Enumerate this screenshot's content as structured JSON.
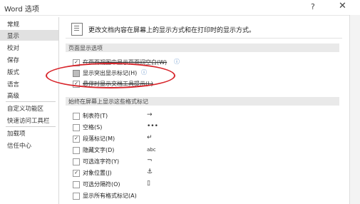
{
  "window": {
    "title": "Word 选项",
    "help": "?",
    "close": "✕"
  },
  "nav": {
    "items": [
      {
        "label": "常规"
      },
      {
        "label": "显示",
        "active": true
      },
      {
        "label": "校对"
      },
      {
        "label": "保存"
      },
      {
        "label": "版式"
      },
      {
        "label": "语言"
      },
      {
        "label": "高级"
      },
      {
        "label": "自定义功能区"
      },
      {
        "label": "快速访问工具栏"
      },
      {
        "label": "加载项"
      },
      {
        "label": "信任中心"
      }
    ]
  },
  "main": {
    "header": "更改文档内容在屏幕上的显示方式和在打印时的显示方式。",
    "page_display": {
      "title": "页面显示选项",
      "options": [
        {
          "label": "在页面视图中显示页面间空白(W)",
          "checked": true,
          "info": "ⓘ"
        },
        {
          "label": "显示突出显示标记(H)",
          "checked": false,
          "info": "ⓘ"
        },
        {
          "label": "悬停时显示文档工具提示(L)",
          "checked": true,
          "info": ""
        }
      ]
    },
    "format_marks": {
      "title": "始终在屏幕上显示这些格式标记",
      "options": [
        {
          "label": "制表符(T)",
          "checked": false,
          "symbol": "→"
        },
        {
          "label": "空格(S)",
          "checked": false,
          "symbol": "•••"
        },
        {
          "label": "段落标记(M)",
          "checked": true,
          "symbol": "↵"
        },
        {
          "label": "隐藏文字(D)",
          "checked": false,
          "symbol": "abc"
        },
        {
          "label": "可选连字符(Y)",
          "checked": false,
          "symbol": "¬"
        },
        {
          "label": "对象位置(J)",
          "checked": true,
          "symbol": "⚓"
        },
        {
          "label": "可选分隔符(O)",
          "checked": false,
          "symbol": "▯"
        },
        {
          "label": "显示所有格式标记(A)",
          "checked": false,
          "symbol": ""
        }
      ]
    }
  }
}
